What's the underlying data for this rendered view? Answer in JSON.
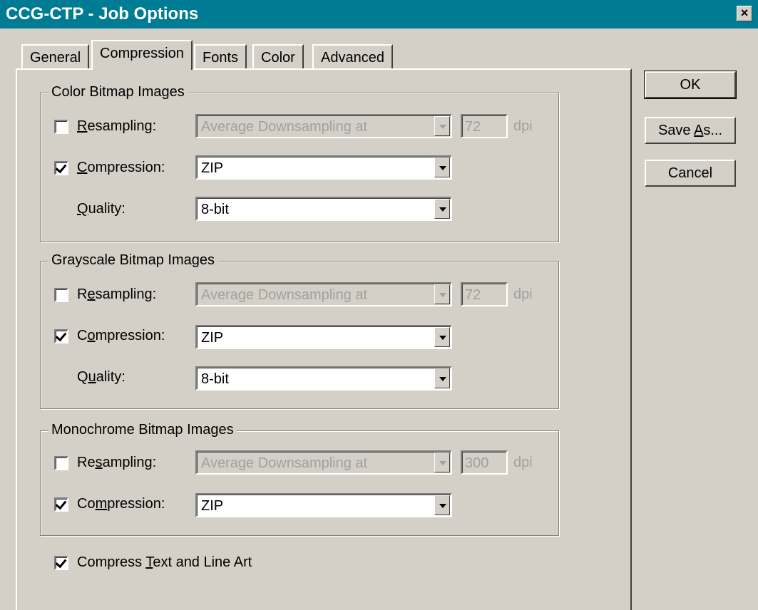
{
  "window": {
    "title": "CCG-CTP - Job Options",
    "close": "×"
  },
  "tabs": [
    {
      "label": "General"
    },
    {
      "label": "Compression"
    },
    {
      "label": "Fonts"
    },
    {
      "label": "Color"
    },
    {
      "label": "Advanced"
    }
  ],
  "color_group": {
    "title": "Color Bitmap Images",
    "resampling": {
      "label_pre": "",
      "mnemonic": "R",
      "label_post": "esampling:",
      "checked": false,
      "method": "Average Downsampling at",
      "dpi": "72",
      "unit": "dpi"
    },
    "compression": {
      "label_pre": "",
      "mnemonic": "C",
      "label_post": "ompression:",
      "checked": true,
      "value": "ZIP"
    },
    "quality": {
      "label_pre": "",
      "mnemonic": "Q",
      "label_post": "uality:",
      "value": "8-bit"
    }
  },
  "gray_group": {
    "title": "Grayscale Bitmap Images",
    "resampling": {
      "label_pre": "R",
      "mnemonic": "e",
      "label_post": "sampling:",
      "checked": false,
      "method": "Average Downsampling at",
      "dpi": "72",
      "unit": "dpi"
    },
    "compression": {
      "label_pre": "C",
      "mnemonic": "o",
      "label_post": "mpression:",
      "checked": true,
      "value": "ZIP"
    },
    "quality": {
      "label_pre": "Q",
      "mnemonic": "u",
      "label_post": "ality:",
      "value": "8-bit"
    }
  },
  "mono_group": {
    "title": "Monochrome Bitmap Images",
    "resampling": {
      "label_pre": "Re",
      "mnemonic": "s",
      "label_post": "ampling:",
      "checked": false,
      "method": "Average Downsampling at",
      "dpi": "300",
      "unit": "dpi"
    },
    "compression": {
      "label_pre": "Co",
      "mnemonic": "m",
      "label_post": "pression:",
      "checked": true,
      "value": "ZIP"
    }
  },
  "compress_text": {
    "label_pre": "Compress ",
    "mnemonic": "T",
    "label_post": "ext and Line Art",
    "checked": true
  },
  "buttons": {
    "ok": "OK",
    "save_as_pre": "Save ",
    "save_as_mnemonic": "A",
    "save_as_post": "s...",
    "cancel": "Cancel"
  }
}
